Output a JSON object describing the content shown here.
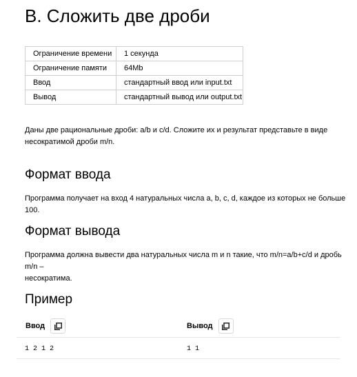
{
  "title": "B. Сложить две дроби",
  "limits": [
    {
      "key": "Ограничение времени",
      "value": "1 секунда"
    },
    {
      "key": "Ограничение памяти",
      "value": "64Mb"
    },
    {
      "key": "Ввод",
      "value": "стандартный ввод или input.txt"
    },
    {
      "key": "Вывод",
      "value": "стандартный вывод или output.txt"
    }
  ],
  "statement": {
    "line1": "Даны две рациональные дроби: a/b и c/d. Сложите их и результат представьте в виде",
    "line2": "несократимой дроби m/n."
  },
  "input_format": {
    "heading": "Формат ввода",
    "text": "Программа получает на вход 4 натуральных числа a, b, c, d, каждое из которых не больше 100."
  },
  "output_format": {
    "heading": "Формат вывода",
    "line1": "Программа должна вывести два натуральных числа m и n такие, что m/n=a/b+c/d и дробь m/n –",
    "line2": "несократима."
  },
  "example": {
    "heading": "Пример",
    "input_label": "Ввод",
    "output_label": "Вывод",
    "input_value": "1 2 1 2",
    "output_value": "1 1"
  },
  "icons": {
    "copy": "copy-icon"
  }
}
